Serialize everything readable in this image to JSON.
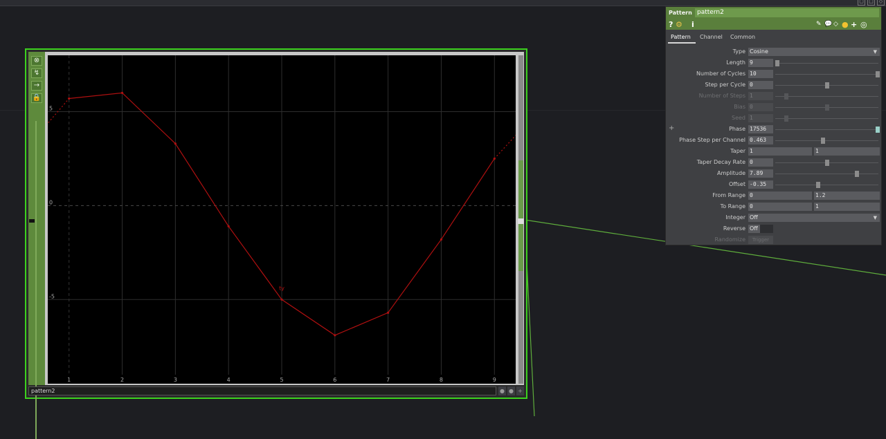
{
  "window": {
    "buttons": [
      "▢",
      "□",
      "◇"
    ]
  },
  "node": {
    "name": "pattern2",
    "tool_icons": [
      "⊗",
      "↯",
      "→",
      "🔒"
    ],
    "footer_icons": [
      "●",
      "●",
      "+"
    ]
  },
  "chart_data": {
    "type": "line",
    "series": [
      {
        "values_x": [
          1,
          2,
          3,
          4,
          5,
          6,
          7,
          8,
          9
        ],
        "values_y": [
          5.7,
          6.0,
          3.3,
          -1.1,
          -5.0,
          -6.9,
          -5.7,
          -1.8,
          2.5
        ]
      }
    ],
    "channel_label": "ty",
    "x_ticks": [
      "1",
      "2",
      "3",
      "4",
      "5",
      "6",
      "7",
      "8",
      "9"
    ],
    "y_ticks": [
      "5",
      "0",
      "-5"
    ],
    "xlim": [
      0.6,
      9.4
    ],
    "ylim": [
      -9,
      8
    ],
    "color": "#b01010"
  },
  "panel": {
    "op_type": "Pattern",
    "op_name": "pattern2",
    "icons": [
      "?",
      "⚙",
      "i",
      "✎",
      "💬",
      "◇",
      "●",
      "+",
      "◎"
    ],
    "tabs": [
      "Pattern",
      "Channel",
      "Common"
    ],
    "params": {
      "type": {
        "label": "Type",
        "value": "Cosine"
      },
      "length": {
        "label": "Length",
        "value": "9"
      },
      "cycles": {
        "label": "Number of Cycles",
        "value": "10"
      },
      "step_per_cycle": {
        "label": "Step per Cycle",
        "value": "0"
      },
      "num_steps": {
        "label": "Number of Steps",
        "value": "1"
      },
      "bias": {
        "label": "Bias",
        "value": "0"
      },
      "seed": {
        "label": "Seed",
        "value": "1"
      },
      "phase": {
        "label": "Phase",
        "value": "17536"
      },
      "phase_step": {
        "label": "Phase Step per Channel",
        "value": "0.463"
      },
      "taper": {
        "label": "Taper",
        "value": "1",
        "value2": "1"
      },
      "taper_decay": {
        "label": "Taper Decay Rate",
        "value": "0"
      },
      "amplitude": {
        "label": "Amplitude",
        "value": "7.89"
      },
      "offset": {
        "label": "Offset",
        "value": "-0.35"
      },
      "from_range": {
        "label": "From Range",
        "value": "0",
        "value2": "1.2"
      },
      "to_range": {
        "label": "To Range",
        "value": "0",
        "value2": "1"
      },
      "integer": {
        "label": "Integer",
        "value": "Off"
      },
      "reverse": {
        "label": "Reverse",
        "value": "Off"
      },
      "randomize": {
        "label": "Randomize",
        "value": "Trigger"
      }
    },
    "plus_sign": "+"
  }
}
